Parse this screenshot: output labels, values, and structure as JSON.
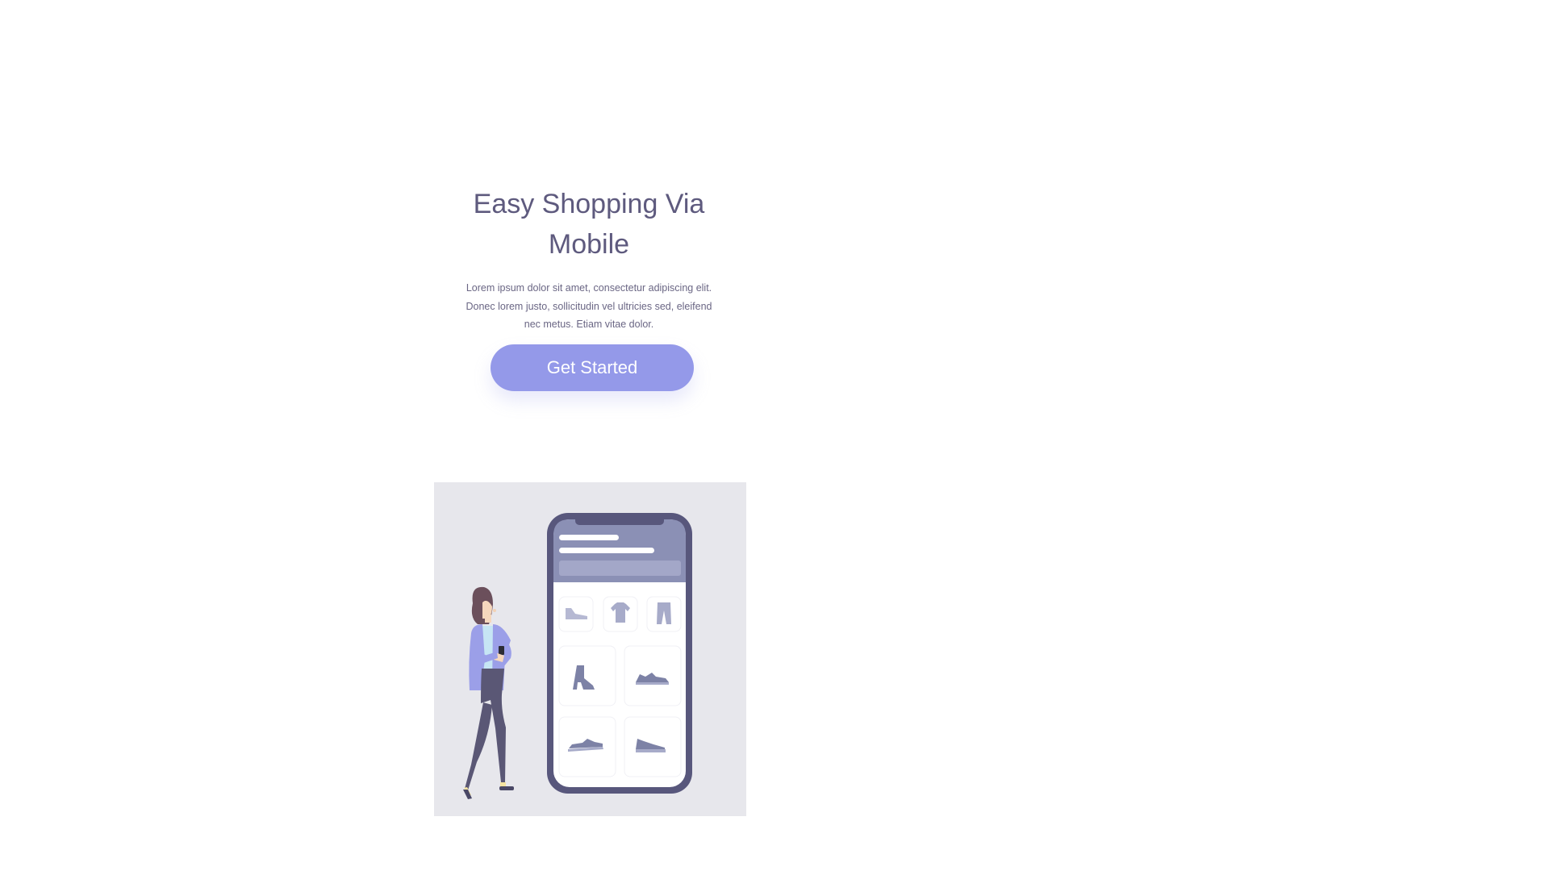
{
  "hero": {
    "title": "Easy Shopping Via Mobile",
    "description": "Lorem ipsum dolor sit amet, consectetur adipiscing elit. Donec lorem justo, sollicitudin vel ultricies sed, eleifend nec metus. Etiam vitae dolor.",
    "cta_label": "Get Started"
  },
  "colors": {
    "title_text": "#5e5a7e",
    "body_text": "#6a6684",
    "cta_background": "#9499e9",
    "cta_text": "#ffffff",
    "illustration_background": "#e7e7ec",
    "phone_frame": "#58577c",
    "phone_header": "#8b90b5",
    "product_icon": "#8e92b4"
  },
  "illustration": {
    "icons": [
      "woman-with-phone-icon",
      "phone-mockup-icon",
      "sneaker-icon",
      "t-shirt-icon",
      "pants-icon",
      "boot-icon",
      "shoe-icon"
    ]
  }
}
